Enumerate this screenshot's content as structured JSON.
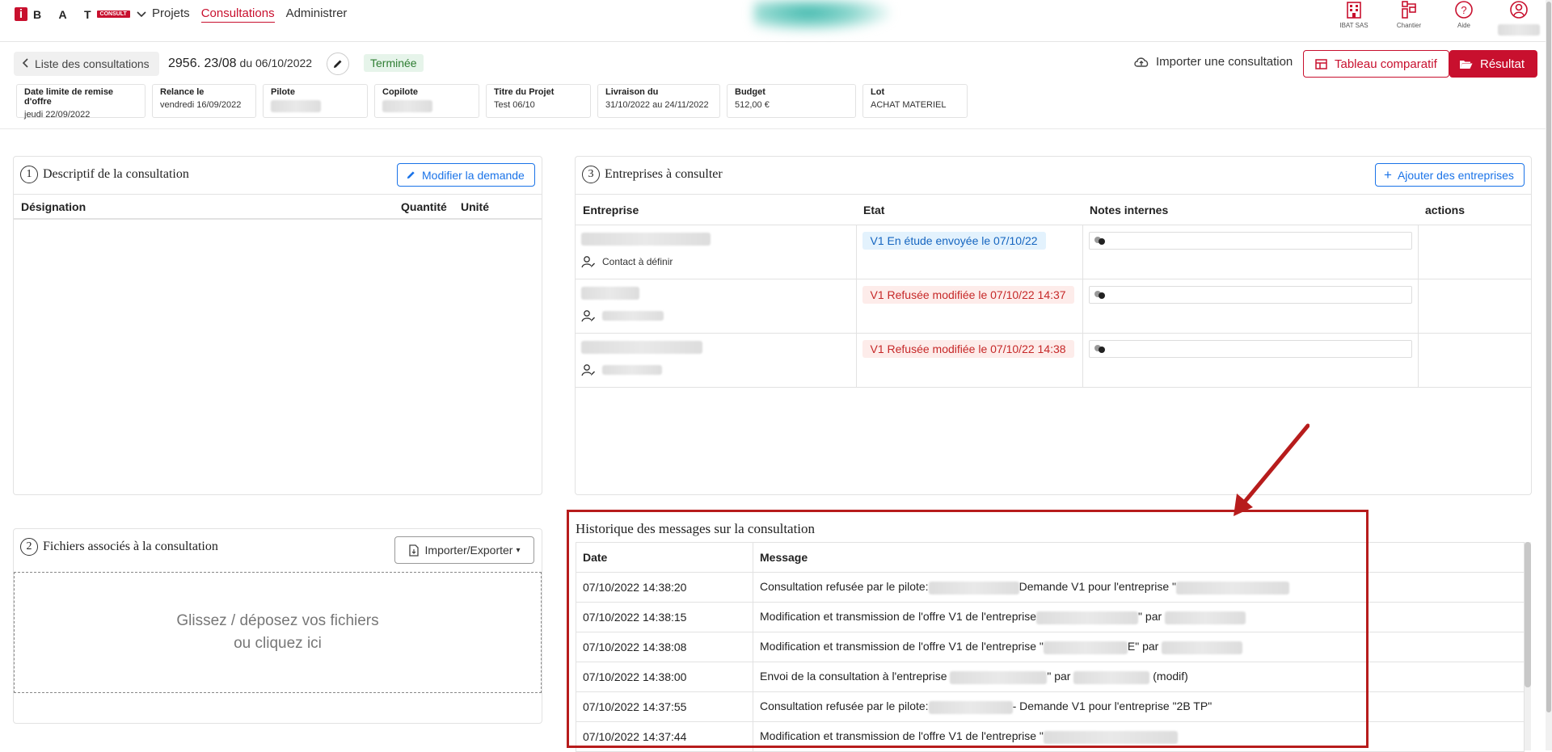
{
  "nav": {
    "logo_letters": "B A T",
    "logo_badge": "CONSULT",
    "items": [
      "Projets",
      "Consultations",
      "Administrer"
    ]
  },
  "top_icons": {
    "company_label": "IBAT SAS",
    "chantier_label": "Chantier",
    "aide_label": "Aide"
  },
  "header": {
    "back_label": "Liste des consultations",
    "consultation_number": "2956. 23/08",
    "consultation_date": "du 06/10/2022",
    "status": "Terminée",
    "import_label": "Importer une consultation",
    "compare_label": "Tableau comparatif",
    "result_label": "Résultat"
  },
  "meta": [
    {
      "label": "Date limite de remise d'offre",
      "value": "jeudi 22/09/2022"
    },
    {
      "label": "Relance le",
      "value": "vendredi 16/09/2022"
    },
    {
      "label": "Pilote",
      "value": ""
    },
    {
      "label": "Copilote",
      "value": ""
    },
    {
      "label": "Titre du Projet",
      "value": "Test 06/10"
    },
    {
      "label": "Livraison du",
      "value": "31/10/2022 au 24/11/2022"
    },
    {
      "label": "Budget",
      "value": "512,00 €"
    },
    {
      "label": "Lot",
      "value": "ACHAT MATERIEL"
    }
  ],
  "panel1": {
    "number": "1",
    "title": "Descriptif de la consultation",
    "edit_button": "Modifier la demande",
    "columns": [
      "Désignation",
      "Quantité",
      "Unité"
    ]
  },
  "panel2": {
    "number": "2",
    "title": "Fichiers associés à la consultation",
    "import_export_button": "Importer/Exporter",
    "dropzone_line1": "Glissez / déposez vos fichiers",
    "dropzone_line2": "ou cliquez ici"
  },
  "panel3": {
    "number": "3",
    "title": "Entreprises à consulter",
    "add_button": "Ajouter des entreprises",
    "columns": [
      "Entreprise",
      "Etat",
      "Notes internes",
      "actions"
    ],
    "rows": [
      {
        "contact": "Contact à définir",
        "etat": "V1 En étude envoyée le 07/10/22",
        "etat_color": "blue"
      },
      {
        "contact": "",
        "etat": "V1 Refusée modifiée le 07/10/22 14:37",
        "etat_color": "red"
      },
      {
        "contact": "",
        "etat": "V1 Refusée modifiée le 07/10/22 14:38",
        "etat_color": "red"
      }
    ]
  },
  "history": {
    "title": "Historique des messages sur la consultation",
    "columns": [
      "Date",
      "Message"
    ],
    "rows": [
      {
        "date": "07/10/2022 14:38:20",
        "m1": "Consultation refusée par le pilote:",
        "m2": "Demande V1 pour l'entreprise \"",
        "m3": ""
      },
      {
        "date": "07/10/2022 14:38:15",
        "m1": "Modification et transmission de l'offre V1 de l'entreprise",
        "m2": "\" par ",
        "m3": ""
      },
      {
        "date": "07/10/2022 14:38:08",
        "m1": "Modification et transmission de l'offre V1 de l'entreprise \"",
        "m2": "E\" par ",
        "m3": ""
      },
      {
        "date": "07/10/2022 14:38:00",
        "m1": "Envoi de la consultation à l'entreprise",
        "m2": "\" par",
        "m3": "(modif)"
      },
      {
        "date": "07/10/2022 14:37:55",
        "m1": "Consultation refusée par le pilote:",
        "m2": "- Demande V1 pour l'entreprise \"2B TP\"",
        "m3": ""
      },
      {
        "date": "07/10/2022 14:37:44",
        "m1": "Modification et transmission de l'offre V1 de l'entreprise \"",
        "m2": "",
        "m3": ""
      }
    ]
  },
  "colors": {
    "brand_red": "#c8102e",
    "link_blue": "#1a73e8",
    "annotation_red": "#b71c1c"
  }
}
